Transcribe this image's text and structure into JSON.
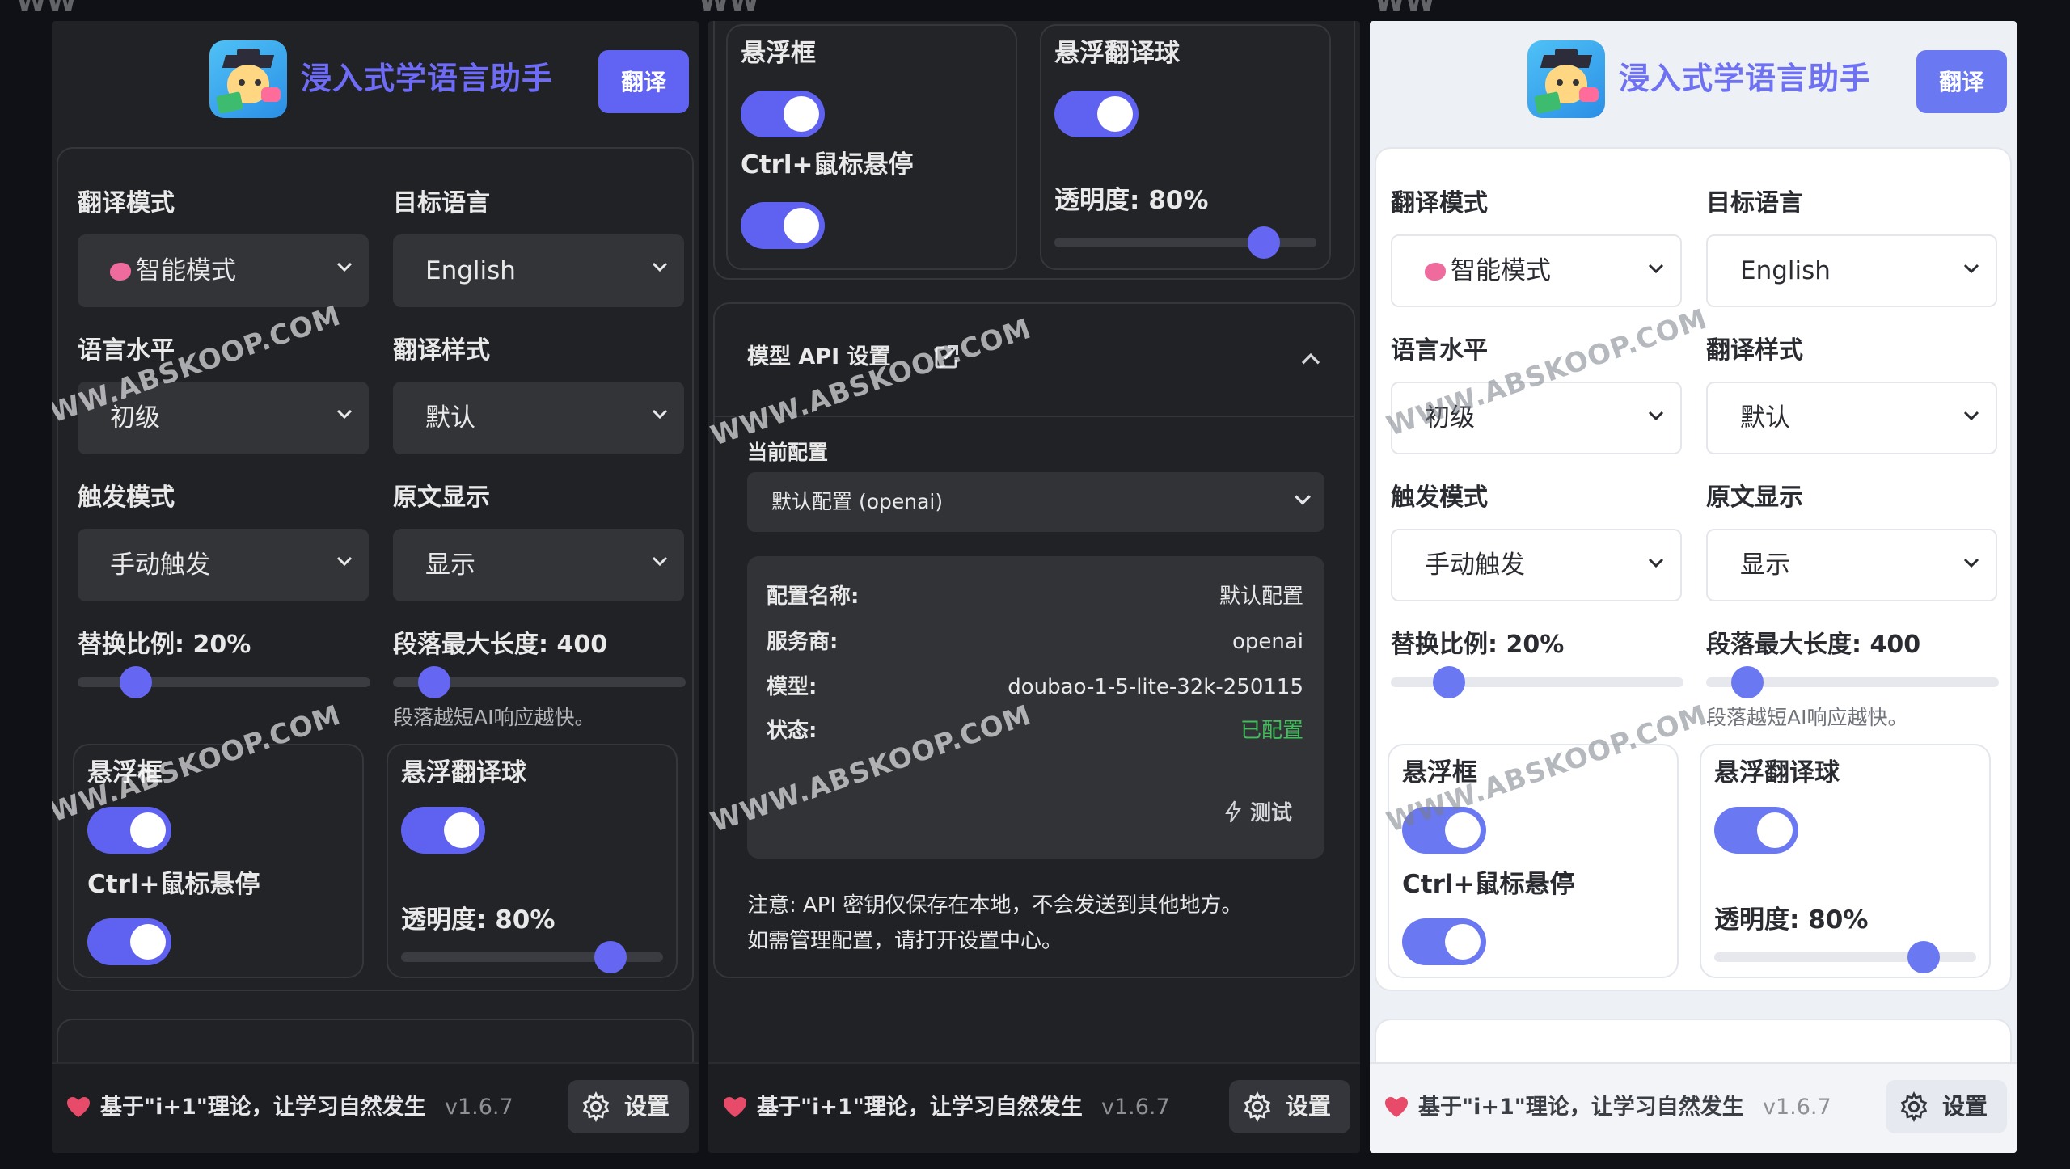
{
  "app": {
    "title": "浸入式学语言助手",
    "translate_button": "翻译"
  },
  "settings": {
    "translation_mode": {
      "label": "翻译模式",
      "value": "智能模式"
    },
    "target_language": {
      "label": "目标语言",
      "value": "English"
    },
    "language_level": {
      "label": "语言水平",
      "value": "初级"
    },
    "translation_style": {
      "label": "翻译样式",
      "value": "默认"
    },
    "trigger_mode": {
      "label": "触发模式",
      "value": "手动触发"
    },
    "original_display": {
      "label": "原文显示",
      "value": "显示"
    },
    "replace_ratio": {
      "label": "替换比例: 20%",
      "value": 0.2
    },
    "max_paragraph_length": {
      "label": "段落最大长度: 400",
      "value": 400,
      "hint": "段落越短AI响应越快。"
    },
    "floating_box": {
      "title": "悬浮框",
      "enabled": true
    },
    "ctrl_hover": {
      "label": "Ctrl+鼠标悬停",
      "enabled": true
    },
    "floating_ball": {
      "title": "悬浮翻译球",
      "enabled": true
    },
    "opacity": {
      "label": "透明度: 80%",
      "value": 0.8
    }
  },
  "api": {
    "section_title": "模型 API 设置",
    "current_config_label": "当前配置",
    "current_config_value": "默认配置 (openai)",
    "rows": [
      {
        "key": "配置名称:",
        "value": "默认配置"
      },
      {
        "key": "服务商:",
        "value": "openai"
      },
      {
        "key": "模型:",
        "value": "doubao-1-5-lite-32k-250115"
      },
      {
        "key": "状态:",
        "value": "已配置"
      }
    ],
    "test_button": "测试",
    "note_line1": "注意: API 密钥仅保存在本地，不会发送到其他地方。",
    "note_line2": "如需管理配置，请打开设置中心。"
  },
  "footer": {
    "slogan": "基于\"i+1\"理论，让学习自然发生",
    "version": "v1.6.7",
    "settings_button": "设置"
  },
  "watermark": "WWW.ABSKOOP.COM",
  "watermark_corner": "WW",
  "colors": {
    "accent": "#6163f2",
    "dark_bg": "#202226",
    "light_bg": "#edf0f5",
    "status_ok": "#3fbf5a"
  }
}
